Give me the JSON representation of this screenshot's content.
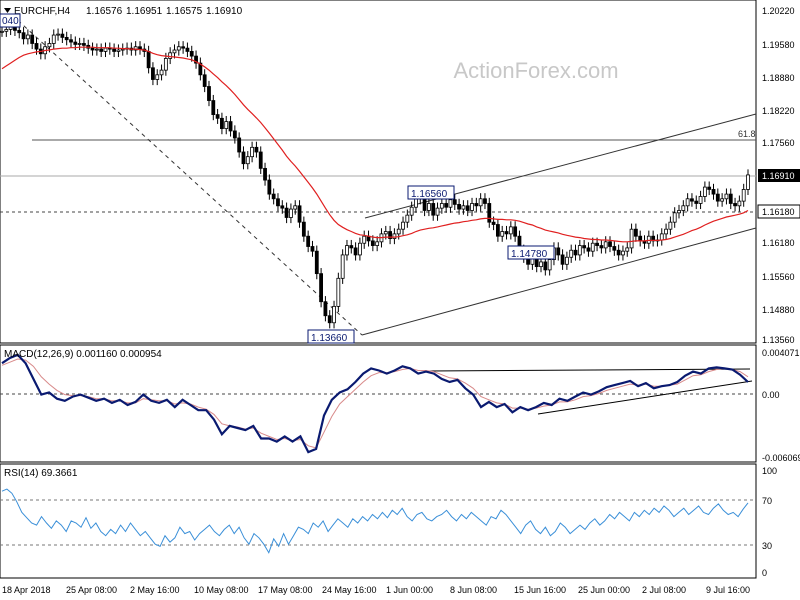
{
  "header": {
    "dropdown_icon": "triangle-down-icon",
    "symbol": "EURCHF,H4",
    "open": "1.16576",
    "high": "1.16951",
    "low": "1.16575",
    "close": "1.16910"
  },
  "watermark": "ActionForex.com",
  "price_panel": {
    "cut_label": "040",
    "axis_ticks": [
      "1.20220",
      "1.19580",
      "1.18880",
      "1.18220",
      "1.17560",
      "1.16910",
      "1.16180",
      "1.15560",
      "1.14880",
      "1.14220",
      "1.13560"
    ],
    "fib_label": "61.8",
    "current_price": "1.16910",
    "support_price": "1.16180",
    "annotations": [
      {
        "id": "low1",
        "text": "1.13660"
      },
      {
        "id": "high1",
        "text": "1.16560"
      },
      {
        "id": "low2",
        "text": "1.14780"
      }
    ]
  },
  "macd_panel": {
    "label": "MACD(12,26,9) 0.001160 0.000954",
    "axis_ticks": [
      "0.004071",
      "0.00",
      "-0.006069"
    ]
  },
  "rsi_panel": {
    "label": "RSI(14) 69.3661",
    "axis_ticks": [
      "100",
      "70",
      "30",
      "0"
    ]
  },
  "x_axis": {
    "labels": [
      "18 Apr 2018",
      "25 Apr 08:00",
      "2 May 16:00",
      "10 May 08:00",
      "17 May 08:00",
      "24 May 16:00",
      "1 Jun 00:00",
      "8 Jun 08:00",
      "15 Jun 16:00",
      "25 Jun 00:00",
      "2 Jul 08:00",
      "9 Jul 16:00"
    ]
  },
  "colors": {
    "candle": "#000000",
    "ma": "#e02020",
    "macd": "#0a1a70",
    "signal": "#d88a8a",
    "rsi": "#3a8fd8",
    "current_box": "#000000",
    "annotation_border": "#0a1a70",
    "grid": "#7a7a7a"
  },
  "chart_data": [
    {
      "type": "candlestick",
      "title": "EURCHF,H4",
      "ylim": [
        1.1336,
        1.2035
      ],
      "close": [
        1.1998,
        1.2002,
        1.201,
        1.2,
        1.1995,
        1.1982,
        1.199,
        1.1972,
        1.196,
        1.195,
        1.1965,
        1.1972,
        1.199,
        1.1992,
        1.1985,
        1.198,
        1.1975,
        1.197,
        1.1972,
        1.1968,
        1.1962,
        1.1958,
        1.196,
        1.1955,
        1.1962,
        1.196,
        1.1955,
        1.1958,
        1.196,
        1.1962,
        1.1958,
        1.1965,
        1.196,
        1.1955,
        1.192,
        1.1895,
        1.1905,
        1.1915,
        1.194,
        1.1952,
        1.1958,
        1.1965,
        1.1962,
        1.1955,
        1.1945,
        1.193,
        1.1905,
        1.188,
        1.185,
        1.182,
        1.1812,
        1.179,
        1.1805,
        1.1785,
        1.177,
        1.174,
        1.1715,
        1.173,
        1.175,
        1.174,
        1.1705,
        1.168,
        1.165,
        1.164,
        1.1625,
        1.162,
        1.16,
        1.1618,
        1.1625,
        1.159,
        1.156,
        1.1538,
        1.1528,
        1.148,
        1.142,
        1.139,
        1.1375,
        1.141,
        1.147,
        1.152,
        1.154,
        1.1535,
        1.152,
        1.1545,
        1.156,
        1.155,
        1.154,
        1.1548,
        1.1565,
        1.157,
        1.1555,
        1.1565,
        1.1575,
        1.159,
        1.1605,
        1.1622,
        1.1645,
        1.164,
        1.1615,
        1.163,
        1.1605,
        1.162,
        1.163,
        1.1622,
        1.1638,
        1.1628,
        1.1618,
        1.1625,
        1.1615,
        1.163,
        1.1625,
        1.164,
        1.163,
        1.159,
        1.1585,
        1.156,
        1.157,
        1.1565,
        1.158,
        1.156,
        1.153,
        1.1515,
        1.15,
        1.1518,
        1.1495,
        1.1505,
        1.1488,
        1.151,
        1.1535,
        1.152,
        1.15,
        1.1515,
        1.153,
        1.152,
        1.154,
        1.1535,
        1.1528,
        1.1545,
        1.154,
        1.1535,
        1.1548,
        1.1538,
        1.153,
        1.152,
        1.1528,
        1.1535,
        1.1575,
        1.156,
        1.155,
        1.1545,
        1.156,
        1.155,
        1.1552,
        1.1565,
        1.1575,
        1.159,
        1.161,
        1.1615,
        1.1625,
        1.164,
        1.1635,
        1.163,
        1.1645,
        1.1665,
        1.166,
        1.165,
        1.1635,
        1.164,
        1.165,
        1.163,
        1.1625,
        1.1635,
        1.166,
        1.1691
      ],
      "ma_close": [
        1.1918,
        1.1924,
        1.193,
        1.1936,
        1.1942,
        1.1947,
        1.195,
        1.1952,
        1.1954,
        1.1955,
        1.1957,
        1.1958,
        1.196,
        1.1961,
        1.1962,
        1.1962,
        1.1963,
        1.1963,
        1.1964,
        1.1964,
        1.1964,
        1.1964,
        1.1963,
        1.1963,
        1.1963,
        1.1963,
        1.1962,
        1.1962,
        1.1961,
        1.1961,
        1.196,
        1.196,
        1.1959,
        1.1958,
        1.1955,
        1.1951,
        1.1948,
        1.1946,
        1.1945,
        1.1944,
        1.1943,
        1.1942,
        1.1941,
        1.1939,
        1.1937,
        1.1933,
        1.1928,
        1.1922,
        1.1915,
        1.1907,
        1.1899,
        1.189,
        1.1882,
        1.1873,
        1.1863,
        1.1852,
        1.1841,
        1.1831,
        1.1822,
        1.1813,
        1.1803,
        1.1792,
        1.178,
        1.1768,
        1.1756,
        1.1744,
        1.1731,
        1.172,
        1.171,
        1.1699,
        1.1687,
        1.1675,
        1.1663,
        1.165,
        1.1635,
        1.162,
        1.1606,
        1.1594,
        1.1585,
        1.1579,
        1.1574,
        1.157,
        1.1566,
        1.1563,
        1.1562,
        1.156,
        1.1558,
        1.1557,
        1.1557,
        1.1558,
        1.1558,
        1.1558,
        1.1559,
        1.1561,
        1.1563,
        1.1566,
        1.157,
        1.1573,
        1.1575,
        1.1577,
        1.1578,
        1.158,
        1.1582,
        1.1584,
        1.1586,
        1.1588,
        1.1589,
        1.1591,
        1.1592,
        1.1594,
        1.1595,
        1.1597,
        1.1598,
        1.1598,
        1.1597,
        1.1596,
        1.1596,
        1.1595,
        1.1595,
        1.1594,
        1.1592,
        1.1589,
        1.1586,
        1.1584,
        1.158,
        1.1577,
        1.1573,
        1.1571,
        1.1569,
        1.1567,
        1.1564,
        1.1562,
        1.156,
        1.1558,
        1.1557,
        1.1555,
        1.1554,
        1.1553,
        1.1553,
        1.1552,
        1.1552,
        1.1551,
        1.155,
        1.1549,
        1.1548,
        1.1548,
        1.1549,
        1.155,
        1.155,
        1.155,
        1.1551,
        1.1551,
        1.1551,
        1.1552,
        1.1553,
        1.1555,
        1.1558,
        1.1561,
        1.1564,
        1.1568,
        1.1572,
        1.1575,
        1.1579,
        1.1584,
        1.1588,
        1.1592,
        1.1595,
        1.1598,
        1.1601,
        1.1603,
        1.1605,
        1.1607,
        1.161,
        1.1615
      ],
      "levels": [
        1.1756,
        1.1691,
        1.1618
      ],
      "annotations": [
        1.1366,
        1.1656,
        1.1478
      ]
    },
    {
      "type": "line",
      "title": "MACD(12,26,9)",
      "ylim": [
        -0.006069,
        0.004071
      ],
      "series": [
        {
          "name": "MACD",
          "values": [
            0.003,
            0.0035,
            0.0038,
            0.003,
            0.0015,
            0.0,
            0.0002,
            -0.0004,
            -0.0006,
            -0.0002,
            0.0,
            -0.0003,
            -0.0006,
            -0.0004,
            -0.0008,
            -0.0005,
            -0.001,
            -0.0007,
            0.0,
            -0.0006,
            -0.0008,
            -0.0005,
            -0.0012,
            -0.0005,
            -0.001,
            -0.0015,
            -0.0015,
            -0.0024,
            -0.0038,
            -0.003,
            -0.0032,
            -0.0034,
            -0.003,
            -0.0042,
            -0.0042,
            -0.0045,
            -0.004,
            -0.0045,
            -0.004,
            -0.0055,
            -0.0052,
            -0.002,
            -0.0005,
            0.0002,
            0.0005,
            0.0012,
            0.002,
            0.0025,
            0.0023,
            0.002,
            0.0023,
            0.0027,
            0.0025,
            0.002,
            0.0022,
            0.002,
            0.0015,
            0.0012,
            0.0014,
            0.0006,
            0.0,
            -0.0012,
            -0.0007,
            -0.0012,
            -0.0009,
            -0.0017,
            -0.0012,
            -0.0015,
            -0.0012,
            -0.0008,
            -0.001,
            -0.0004,
            -0.0006,
            -0.0002,
            0.0002,
            0.0,
            0.0003,
            0.0007,
            0.0009,
            0.0011,
            0.0013,
            0.0008,
            0.0011,
            0.0006,
            0.0008,
            0.0009,
            0.0012,
            0.0018,
            0.0022,
            0.002,
            0.0025,
            0.0026,
            0.0025,
            0.0024,
            0.0019,
            0.0012
          ]
        },
        {
          "name": "Signal",
          "values": [
            0.0028,
            0.0031,
            0.0034,
            0.0033,
            0.0027,
            0.0017,
            0.001,
            0.0004,
            0.0,
            -0.0001,
            -0.0001,
            -0.0002,
            -0.0004,
            -0.0004,
            -0.0006,
            -0.0006,
            -0.0008,
            -0.0008,
            -0.0004,
            -0.0005,
            -0.0006,
            -0.0006,
            -0.0009,
            -0.0008,
            -0.0009,
            -0.0012,
            -0.0014,
            -0.0019,
            -0.0028,
            -0.003,
            -0.0031,
            -0.0033,
            -0.0032,
            -0.0037,
            -0.004,
            -0.0043,
            -0.0042,
            -0.0044,
            -0.0043,
            -0.0049,
            -0.0051,
            -0.0036,
            -0.0021,
            -0.0009,
            -0.0002,
            0.0005,
            0.0012,
            0.0018,
            0.0021,
            0.0021,
            0.0022,
            0.0024,
            0.0025,
            0.0023,
            0.0023,
            0.0022,
            0.0019,
            0.0016,
            0.0015,
            0.0011,
            0.0006,
            -0.0002,
            -0.0005,
            -0.0008,
            -0.0009,
            -0.0013,
            -0.0013,
            -0.0014,
            -0.0013,
            -0.0011,
            -0.001,
            -0.0007,
            -0.0007,
            -0.0005,
            -0.0002,
            -0.0001,
            0.0001,
            0.0004,
            0.0006,
            0.0008,
            0.001,
            0.0009,
            0.001,
            0.0008,
            0.0008,
            0.0009,
            0.001,
            0.0014,
            0.0018,
            0.0019,
            0.0022,
            0.0024,
            0.0025,
            0.0024,
            0.0022,
            0.0017
          ]
        }
      ]
    },
    {
      "type": "line",
      "title": "RSI(14)",
      "ylim": [
        0,
        100
      ],
      "levels": [
        70,
        30
      ],
      "series": [
        {
          "name": "RSI(14)",
          "values": [
            80,
            82,
            78,
            70,
            60,
            55,
            50,
            48,
            56,
            50,
            45,
            52,
            48,
            42,
            52,
            50,
            46,
            55,
            45,
            50,
            42,
            38,
            44,
            40,
            48,
            42,
            50,
            44,
            38,
            42,
            36,
            30,
            28,
            38,
            32,
            36,
            46,
            40,
            42,
            34,
            40,
            44,
            48,
            42,
            38,
            44,
            48,
            40,
            46,
            36,
            30,
            40,
            36,
            30,
            22,
            35,
            28,
            40,
            30,
            38,
            46,
            44,
            40,
            50,
            46,
            52,
            42,
            48,
            54,
            50,
            46,
            54,
            50,
            56,
            52,
            58,
            54,
            60,
            55,
            62,
            58,
            64,
            56,
            52,
            58,
            60,
            54,
            52,
            56,
            58,
            62,
            56,
            52,
            58,
            54,
            60,
            56,
            52,
            48,
            56,
            54,
            62,
            58,
            52,
            46,
            40,
            48,
            52,
            44,
            40,
            46,
            38,
            42,
            50,
            46,
            40,
            44,
            48,
            44,
            50,
            54,
            48,
            52,
            58,
            54,
            60,
            56,
            52,
            60,
            56,
            62,
            58,
            64,
            60,
            66,
            62,
            56,
            60,
            64,
            58,
            62,
            66,
            60,
            58,
            64,
            68,
            62,
            58,
            60,
            56,
            63,
            69
          ]
        }
      ]
    }
  ]
}
